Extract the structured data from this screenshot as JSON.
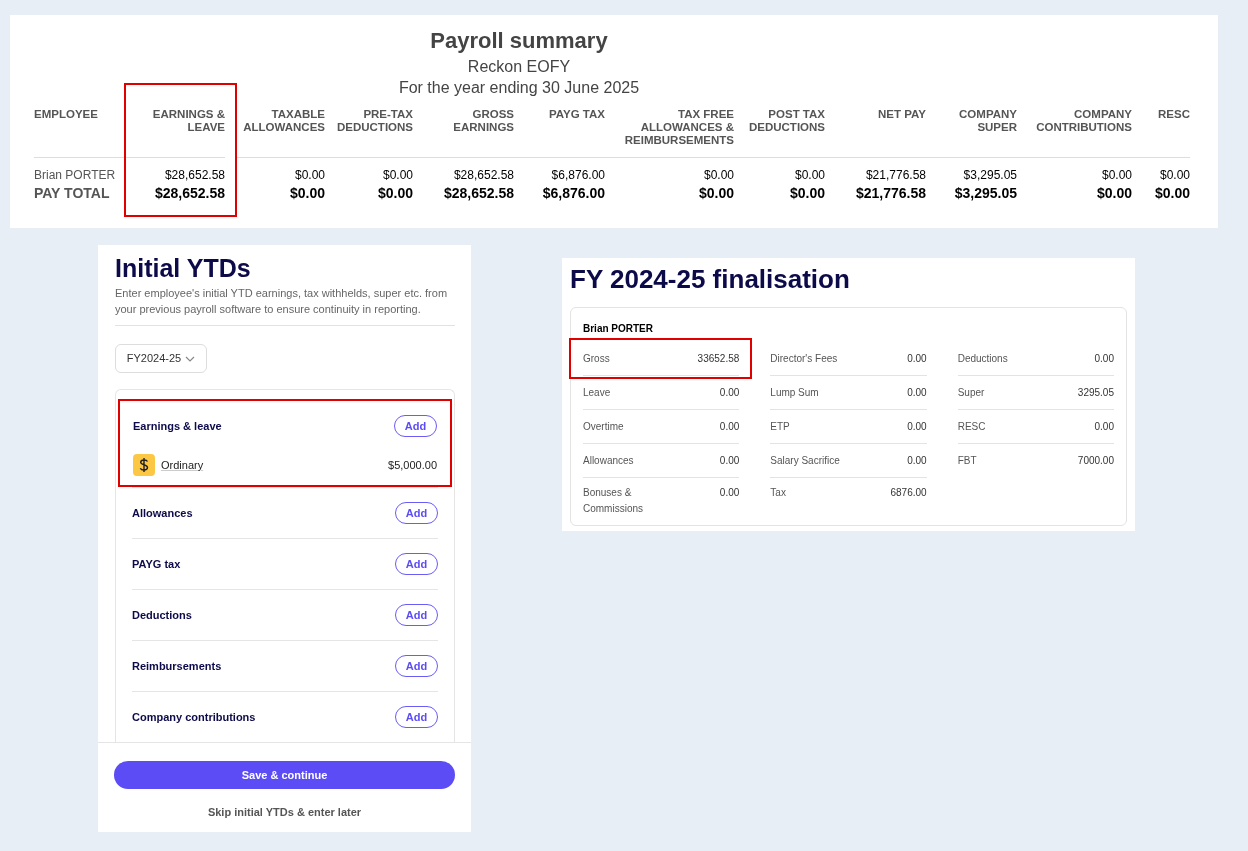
{
  "payroll_summary": {
    "title": "Payroll summary",
    "subtitle": "Reckon EOFY",
    "period": "For the year ending 30 June 2025",
    "columns": [
      {
        "label": "EMPLOYEE",
        "highlighted": false
      },
      {
        "label": "EARNINGS & LEAVE",
        "highlighted": true
      },
      {
        "label": "TAXABLE ALLOWANCES",
        "highlighted": false
      },
      {
        "label": "PRE-TAX DEDUCTIONS",
        "highlighted": false
      },
      {
        "label": "GROSS EARNINGS",
        "highlighted": false
      },
      {
        "label": "PAYG TAX",
        "highlighted": false
      },
      {
        "label": "TAX FREE ALLOWANCES & REIMBURSEMENTS",
        "highlighted": false
      },
      {
        "label": "POST TAX DEDUCTIONS",
        "highlighted": false
      },
      {
        "label": "NET PAY",
        "highlighted": false
      },
      {
        "label": "COMPANY SUPER",
        "highlighted": false
      },
      {
        "label": "COMPANY CONTRIBUTIONS",
        "highlighted": false
      },
      {
        "label": "RESC",
        "highlighted": false
      }
    ],
    "rows": [
      {
        "kind": "employee",
        "cells": [
          "Brian PORTER",
          "$28,652.58",
          "$0.00",
          "$0.00",
          "$28,652.58",
          "$6,876.00",
          "$0.00",
          "$0.00",
          "$21,776.58",
          "$3,295.05",
          "$0.00",
          "$0.00"
        ]
      },
      {
        "kind": "total",
        "cells": [
          "PAY TOTAL",
          "$28,652.58",
          "$0.00",
          "$0.00",
          "$28,652.58",
          "$6,876.00",
          "$0.00",
          "$0.00",
          "$21,776.58",
          "$3,295.05",
          "$0.00",
          "$0.00"
        ]
      }
    ]
  },
  "initial_ytds": {
    "title": "Initial YTDs",
    "description": "Enter employee's initial YTD earnings, tax withhelds, super etc. from your previous payroll software to ensure continuity in reporting.",
    "year_select": {
      "value": "FY2024-25"
    },
    "sections": [
      {
        "label": "Earnings & leave",
        "button": "Add",
        "highlighted": true,
        "items": [
          {
            "label": "Ordinary",
            "amount": "$5,000.00"
          }
        ]
      },
      {
        "label": "Allowances",
        "button": "Add",
        "highlighted": false
      },
      {
        "label": "PAYG tax",
        "button": "Add",
        "highlighted": false
      },
      {
        "label": "Deductions",
        "button": "Add",
        "highlighted": false
      },
      {
        "label": "Reimbursements",
        "button": "Add",
        "highlighted": false
      },
      {
        "label": "Company contributions",
        "button": "Add",
        "highlighted": false
      }
    ],
    "save_button": "Save & continue",
    "skip_link": "Skip initial YTDs & enter later"
  },
  "finalisation": {
    "title": "FY 2024-25 finalisation",
    "employee": "Brian PORTER",
    "columns": [
      [
        {
          "label": "Gross",
          "value": "33652.58",
          "highlighted": true
        },
        {
          "label": "Leave",
          "value": "0.00",
          "highlighted": false
        },
        {
          "label": "Overtime",
          "value": "0.00",
          "highlighted": false
        },
        {
          "label": "Allowances",
          "value": "0.00",
          "highlighted": false
        },
        {
          "label": "Bonuses & Commissions",
          "value": "0.00",
          "highlighted": false
        }
      ],
      [
        {
          "label": "Director's Fees",
          "value": "0.00",
          "highlighted": false
        },
        {
          "label": "Lump Sum",
          "value": "0.00",
          "highlighted": false
        },
        {
          "label": "ETP",
          "value": "0.00",
          "highlighted": false
        },
        {
          "label": "Salary Sacrifice",
          "value": "0.00",
          "highlighted": false
        },
        {
          "label": "Tax",
          "value": "6876.00",
          "highlighted": false
        }
      ],
      [
        {
          "label": "Deductions",
          "value": "0.00",
          "highlighted": false
        },
        {
          "label": "Super",
          "value": "3295.05",
          "highlighted": false
        },
        {
          "label": "RESC",
          "value": "0.00",
          "highlighted": false
        },
        {
          "label": "FBT",
          "value": "7000.00",
          "highlighted": false
        }
      ]
    ]
  }
}
